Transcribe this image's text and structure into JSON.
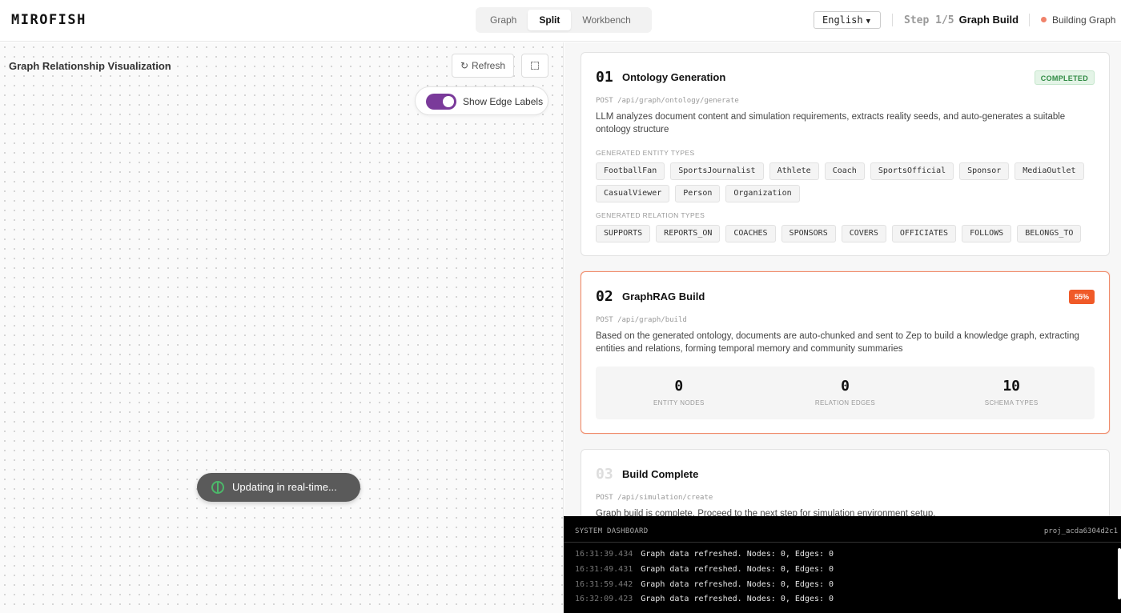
{
  "header": {
    "logo": "MIROFISH",
    "view_tabs": [
      "Graph",
      "Split",
      "Workbench"
    ],
    "active_view": "Split",
    "language": "English",
    "step_label": "Step 1/5",
    "step_name": "Graph Build",
    "status_text": "Building Graph",
    "status_color": "#f0826a"
  },
  "graph_panel": {
    "title": "Graph Relationship Visualization",
    "refresh_label": "Refresh",
    "refresh_icon": "refresh-icon",
    "expand_icon": "expand-icon",
    "edge_labels_toggle": {
      "label": "Show Edge Labels",
      "on": true,
      "color": "#7a3a9a"
    },
    "live_status": "Updating in real-time..."
  },
  "steps": [
    {
      "num": "01",
      "title": "Ontology Generation",
      "badge": "COMPLETED",
      "endpoint": "POST /api/graph/ontology/generate",
      "description": "LLM analyzes document content and simulation requirements, extracts reality seeds, and auto-generates a suitable ontology structure",
      "entity_types_label": "GENERATED ENTITY TYPES",
      "entity_types": [
        "FootballFan",
        "SportsJournalist",
        "Athlete",
        "Coach",
        "SportsOfficial",
        "Sponsor",
        "MediaOutlet",
        "CasualViewer",
        "Person",
        "Organization"
      ],
      "relation_types_label": "GENERATED RELATION TYPES",
      "relation_types": [
        "SUPPORTS",
        "REPORTS_ON",
        "COACHES",
        "SPONSORS",
        "COVERS",
        "OFFICIATES",
        "FOLLOWS",
        "BELONGS_TO"
      ]
    },
    {
      "num": "02",
      "title": "GraphRAG Build",
      "badge": "55%",
      "progress_percent": 55,
      "badge_color": "#f05a28",
      "endpoint": "POST /api/graph/build",
      "description": "Based on the generated ontology, documents are auto-chunked and sent to Zep to build a knowledge graph, extracting entities and relations, forming temporal memory and community summaries",
      "stats": [
        {
          "value": "0",
          "label": "ENTITY NODES"
        },
        {
          "value": "0",
          "label": "RELATION EDGES"
        },
        {
          "value": "10",
          "label": "SCHEMA TYPES"
        }
      ]
    },
    {
      "num": "03",
      "title": "Build Complete",
      "endpoint": "POST /api/simulation/create",
      "description": "Graph build is complete. Proceed to the next step for simulation environment setup."
    }
  ],
  "console": {
    "title": "SYSTEM DASHBOARD",
    "project_id": "proj_acda6304d2c1",
    "logs": [
      {
        "time": "16:31:39.434",
        "message": "Graph data refreshed. Nodes: 0, Edges: 0"
      },
      {
        "time": "16:31:49.431",
        "message": "Graph data refreshed. Nodes: 0, Edges: 0"
      },
      {
        "time": "16:31:59.442",
        "message": "Graph data refreshed. Nodes: 0, Edges: 0"
      },
      {
        "time": "16:32:09.423",
        "message": "Graph data refreshed. Nodes: 0, Edges: 0"
      }
    ]
  }
}
